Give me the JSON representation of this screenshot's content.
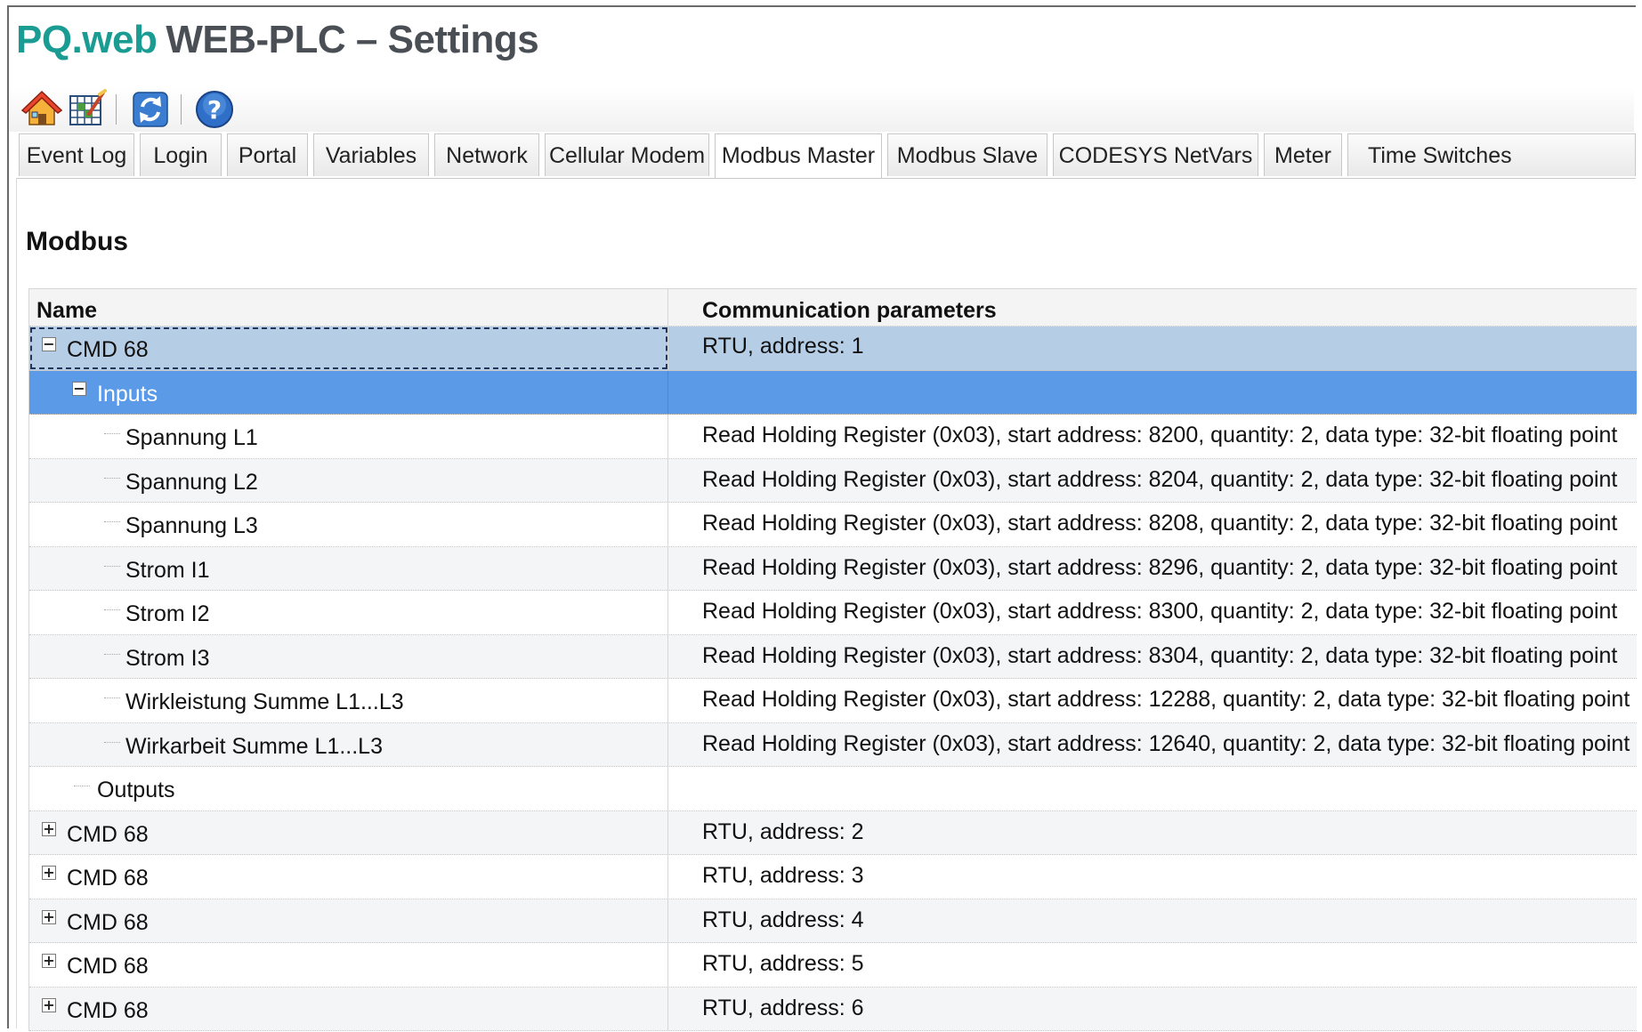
{
  "app": {
    "brand": "PQ.web",
    "title": "WEB-PLC – Settings"
  },
  "toolbar": {
    "icons": [
      "home-icon",
      "grid-icon",
      "refresh-icon",
      "help-icon"
    ]
  },
  "tabs": [
    {
      "label": "Event Log",
      "active": false
    },
    {
      "label": "Login",
      "active": false
    },
    {
      "label": "Portal",
      "active": false
    },
    {
      "label": "Variables",
      "active": false
    },
    {
      "label": "Network",
      "active": false
    },
    {
      "label": "Cellular Modem",
      "active": false
    },
    {
      "label": "Modbus Master",
      "active": true
    },
    {
      "label": "Modbus Slave",
      "active": false
    },
    {
      "label": "CODESYS NetVars",
      "active": false
    },
    {
      "label": "Meter",
      "active": false
    },
    {
      "label": "Time Switches",
      "active": false
    }
  ],
  "section": {
    "title": "Modbus"
  },
  "table": {
    "headers": {
      "name": "Name",
      "params": "Communication parameters"
    },
    "rows": [
      {
        "name": "CMD 68",
        "params": "RTU, address: 1"
      },
      {
        "name": "Inputs",
        "params": ""
      },
      {
        "name": "Spannung L1",
        "params": "Read Holding Register (0x03), start address: 8200, quantity: 2, data type: 32-bit floating point"
      },
      {
        "name": "Spannung L2",
        "params": "Read Holding Register (0x03), start address: 8204, quantity: 2, data type: 32-bit floating point"
      },
      {
        "name": "Spannung L3",
        "params": "Read Holding Register (0x03), start address: 8208, quantity: 2, data type: 32-bit floating point"
      },
      {
        "name": "Strom I1",
        "params": "Read Holding Register (0x03), start address: 8296, quantity: 2, data type: 32-bit floating point"
      },
      {
        "name": "Strom I2",
        "params": "Read Holding Register (0x03), start address: 8300, quantity: 2, data type: 32-bit floating point"
      },
      {
        "name": "Strom I3",
        "params": "Read Holding Register (0x03), start address: 8304, quantity: 2, data type: 32-bit floating point"
      },
      {
        "name": "Wirkleistung Summe L1...L3",
        "params": "Read Holding Register (0x03), start address: 12288, quantity: 2, data type: 32-bit floating point"
      },
      {
        "name": "Wirkarbeit Summe L1...L3",
        "params": "Read Holding Register (0x03), start address: 12640, quantity: 2, data type: 32-bit floating point"
      },
      {
        "name": "Outputs",
        "params": ""
      },
      {
        "name": "CMD 68",
        "params": "RTU, address: 2"
      },
      {
        "name": "CMD 68",
        "params": "RTU, address: 3"
      },
      {
        "name": "CMD 68",
        "params": "RTU, address: 4"
      },
      {
        "name": "CMD 68",
        "params": "RTU, address: 5"
      },
      {
        "name": "CMD 68",
        "params": "RTU, address: 6"
      }
    ]
  }
}
